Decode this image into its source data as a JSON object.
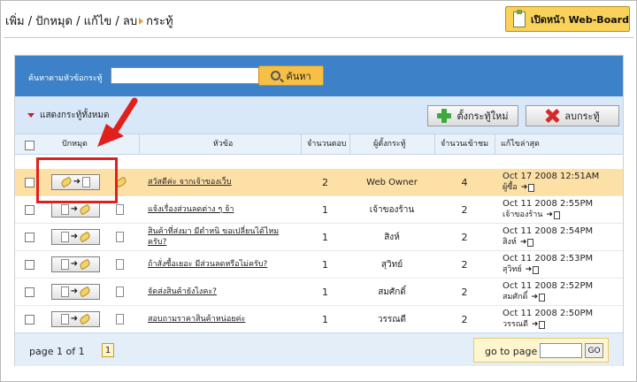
{
  "breadcrumb": {
    "path": "เพิ่ม / ปักหมุด / แก้ไข / ลบ",
    "current": "กระทู้"
  },
  "webboard_button": {
    "label": "เปิดหน้า Web-Board",
    "icon": "document-icon"
  },
  "search": {
    "label": "ค้นหาตามหัวข้อกระทู้",
    "input_value": "",
    "button_label": "ค้นหา",
    "button_icon": "magnifier-icon"
  },
  "toolbar": {
    "show_all_label": "แสดงกระทู้ทั้งหมด",
    "new_topic_label": "ตั้งกระทู้ใหม่",
    "delete_label": "ลบกระทู้"
  },
  "table": {
    "headers": {
      "pin": "ปักหมุด",
      "title": "หัวข้อ",
      "replies": "จำนวนตอบ",
      "author": "ผู้ตั้งกระทู้",
      "views": "จำนวนเข้าชม",
      "last_edit": "แก้ไขล่าสุด"
    },
    "rows": [
      {
        "title": "สวัสดีค่ะ จากเจ้าของเว็บ",
        "replies": "2",
        "author": "Web Owner",
        "views": "4",
        "last_date": "Oct 17 2008 12:51AM",
        "last_by": "ผู้ซื้อ",
        "pinned": true,
        "highlighted": true
      },
      {
        "title": "แจ้งเรื่องส่วนลดต่าง ๆ จ้า",
        "replies": "1",
        "author": "เจ้าของร้าน",
        "views": "2",
        "last_date": "Oct 11 2008 2:55PM",
        "last_by": "เจ้าของร้าน",
        "pinned": false,
        "highlighted": false
      },
      {
        "title": "สินค้าที่ส่งมา มีตำหนิ ขอเปลี่ยนได้ไหมครับ?",
        "title_line1": "สินค้าที่ส่งมา มีตำหนิ ขอเปลี่ยนได้ไหม",
        "title_line2": "ครับ?",
        "replies": "1",
        "author": "สิงห์",
        "views": "2",
        "last_date": "Oct 11 2008 2:54PM",
        "last_by": "สิงห์",
        "pinned": false,
        "highlighted": false
      },
      {
        "title": "ถ้าสั่งซื้อเยอะ มีส่วนลดหรือไม่ครับ?",
        "replies": "1",
        "author": "สุวิทย์",
        "views": "2",
        "last_date": "Oct 11 2008 2:53PM",
        "last_by": "สุวิทย์",
        "pinned": false,
        "highlighted": false
      },
      {
        "title": "จัดส่งสินค้ายังไงคะ?",
        "replies": "1",
        "author": "สมศักดิ์",
        "views": "2",
        "last_date": "Oct 11 2008 2:52PM",
        "last_by": "สมศักดิ์",
        "pinned": false,
        "highlighted": false
      },
      {
        "title": "สอบถามราคาสินค้าหน่อยค่ะ",
        "replies": "1",
        "author": "วรรณดี",
        "views": "2",
        "last_date": "Oct 11 2008 2:50PM",
        "last_by": "วรรณดี",
        "pinned": false,
        "highlighted": false
      }
    ]
  },
  "pagination": {
    "info": "page 1 of 1",
    "current_page": "1",
    "goto_label": "go to page",
    "goto_value": "",
    "go_button": "GO"
  },
  "annotation": {
    "color": "#e0201c"
  },
  "colors": {
    "header_blue": "#3d82c8",
    "toolbar_bg": "#d8e8f8",
    "highlight_row": "#fde0a6",
    "accent_yellow": "#f8d25a"
  }
}
